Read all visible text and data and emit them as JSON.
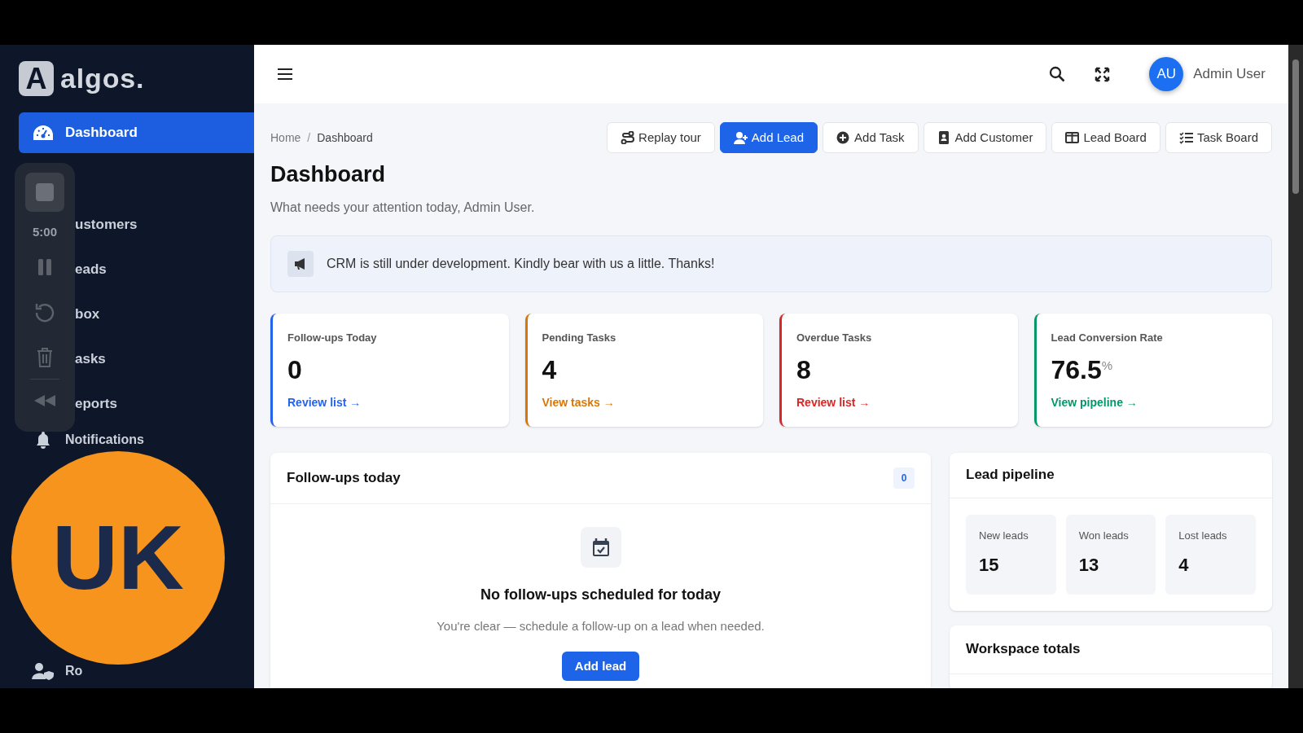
{
  "app": {
    "logo_mark": "A",
    "logo": "algos."
  },
  "sidebar": {
    "items": [
      {
        "label": "Dashboard",
        "selected": true
      },
      {
        "label": "ustomers",
        "selected": false
      },
      {
        "label": "eads",
        "selected": false
      },
      {
        "label": "box",
        "selected": false
      },
      {
        "label": "asks",
        "selected": false
      },
      {
        "label": "eports",
        "selected": false
      },
      {
        "label": "Notifications",
        "selected": false
      },
      {
        "label": "Ro",
        "selected": false
      }
    ]
  },
  "recorder": {
    "timer": "5:00"
  },
  "webcam_badge": {
    "initials": "UK"
  },
  "header": {
    "user": {
      "initials": "AU",
      "name": "Admin User"
    }
  },
  "breadcrumb": {
    "items": [
      "Home",
      "Dashboard"
    ],
    "separator": "/"
  },
  "actions": [
    {
      "label": "Replay tour",
      "primary": false
    },
    {
      "label": "Add Lead",
      "primary": true
    },
    {
      "label": "Add Task",
      "primary": false
    },
    {
      "label": "Add Customer",
      "primary": false
    },
    {
      "label": "Lead Board",
      "primary": false
    },
    {
      "label": "Task Board",
      "primary": false
    }
  ],
  "page": {
    "title": "Dashboard",
    "subtitle": "What needs your attention today, Admin User."
  },
  "notice": "CRM is still under development. Kindly bear with us a little. Thanks!",
  "stats": [
    {
      "label": "Follow-ups Today",
      "value": "0",
      "link": "Review list →",
      "color": "#2563eb"
    },
    {
      "label": "Pending Tasks",
      "value": "4",
      "link": "View tasks →",
      "color": "#d97706"
    },
    {
      "label": "Overdue Tasks",
      "value": "8",
      "link": "Review list →",
      "color": "#dc2626"
    },
    {
      "label": "Lead Conversion Rate",
      "value": "76.5",
      "unit": "%",
      "link": "View pipeline →",
      "color": "#059669"
    }
  ],
  "followups": {
    "title": "Follow-ups today",
    "count": "0",
    "empty_title": "No follow-ups scheduled for today",
    "empty_text": "You're clear — schedule a follow-up on a lead when needed.",
    "button": "Add lead"
  },
  "pipeline": {
    "title": "Lead pipeline",
    "stats": [
      {
        "label": "New leads",
        "value": "15"
      },
      {
        "label": "Won leads",
        "value": "13"
      },
      {
        "label": "Lost leads",
        "value": "4"
      }
    ]
  },
  "workspace_totals": {
    "title": "Workspace totals"
  }
}
